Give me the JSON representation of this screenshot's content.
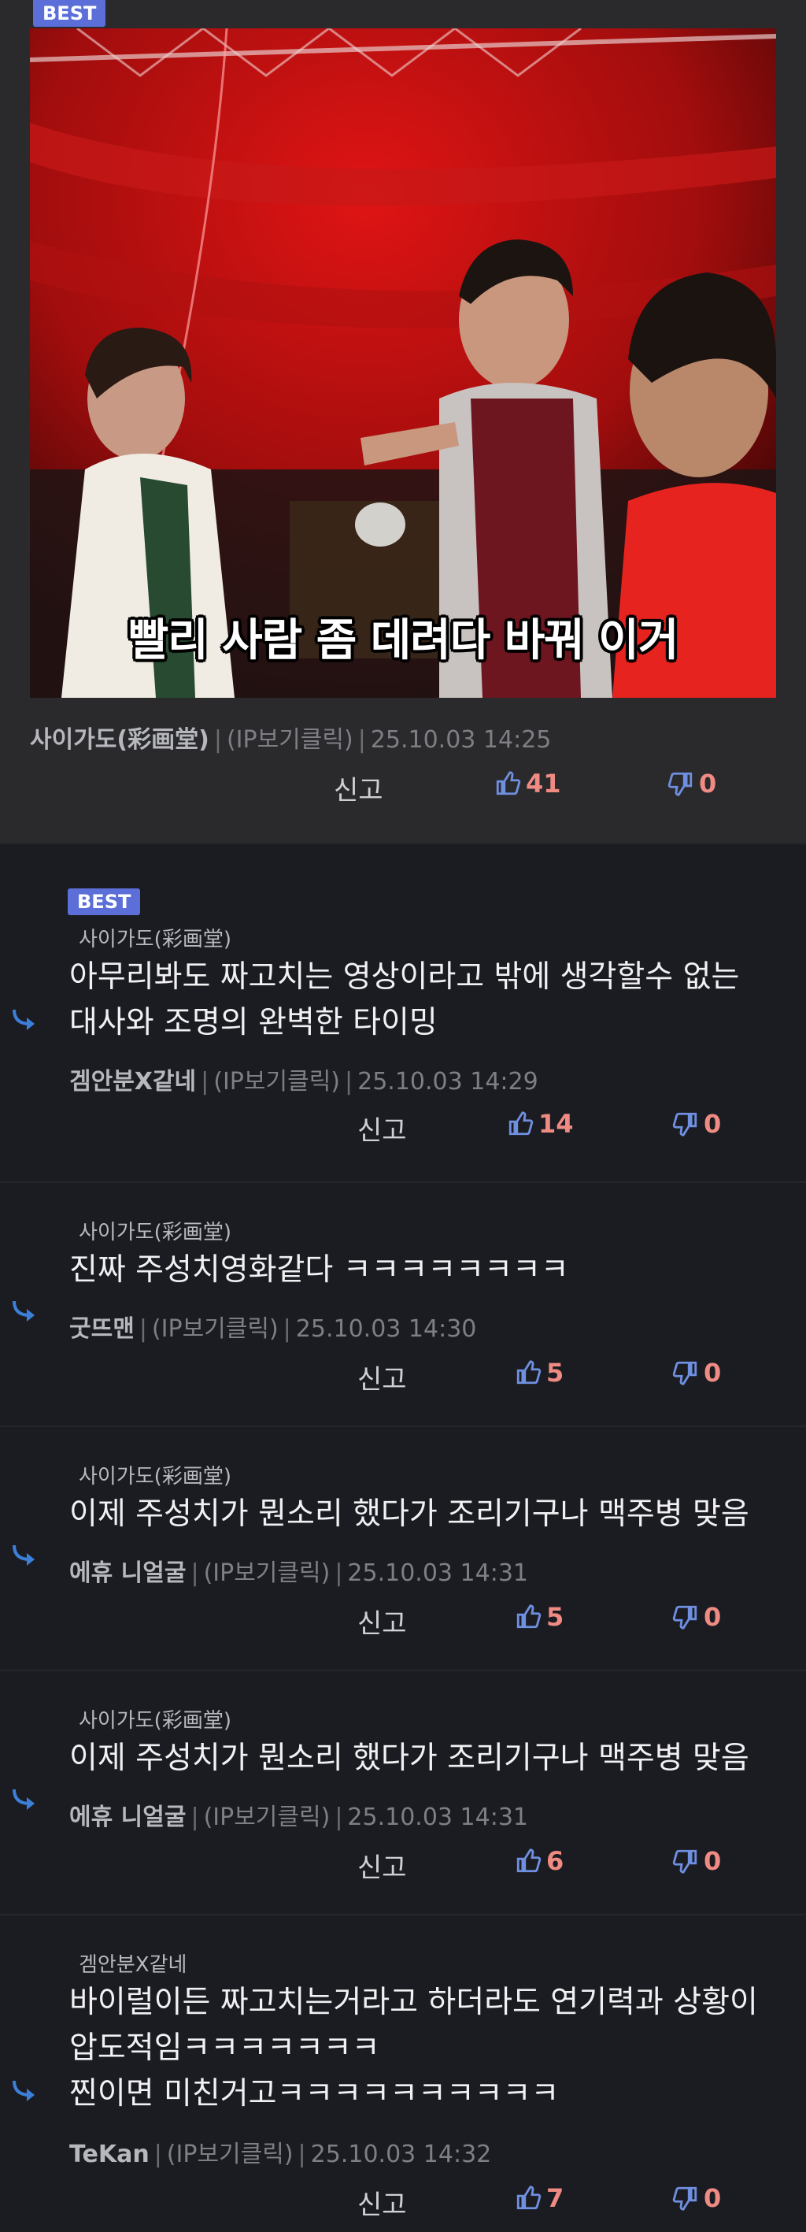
{
  "top": {
    "badge": "BEST",
    "subtitle": "빨리 사람 좀 데려다 바꿔 이거",
    "author": "사이가도(彩画堂)",
    "ip": "(IP보기클릭)",
    "time": "25.10.03 14:25",
    "report": "신고",
    "likes": "41",
    "dislikes": "0"
  },
  "replies": [
    {
      "badge": "BEST",
      "parent": "사이가도(彩画堂)",
      "lines": [
        "아무리봐도 짜고치는 영상이라고 밖에 생각할수 없는",
        "대사와 조명의 완벽한 타이밍"
      ],
      "author": "겜안분X같네",
      "ip": "(IP보기클릭)",
      "time": "25.10.03 14:29",
      "report": "신고",
      "likes": "14",
      "dislikes": "0"
    },
    {
      "parent": "사이가도(彩画堂)",
      "lines": [
        "진짜 주성치영화같다 ㅋㅋㅋㅋㅋㅋㅋㅋ"
      ],
      "author": "굿뜨맨",
      "ip": "(IP보기클릭)",
      "time": "25.10.03 14:30",
      "report": "신고",
      "likes": "5",
      "dislikes": "0"
    },
    {
      "parent": "사이가도(彩画堂)",
      "lines": [
        "이제 주성치가 뭔소리 했다가 조리기구나 맥주병 맞음"
      ],
      "author": "에휴 니얼굴",
      "ip": "(IP보기클릭)",
      "time": "25.10.03 14:31",
      "report": "신고",
      "likes": "5",
      "dislikes": "0"
    },
    {
      "parent": "사이가도(彩画堂)",
      "lines": [
        "이제 주성치가 뭔소리 했다가 조리기구나 맥주병 맞음"
      ],
      "author": "에휴 니얼굴",
      "ip": "(IP보기클릭)",
      "time": "25.10.03 14:31",
      "report": "신고",
      "likes": "6",
      "dislikes": "0"
    },
    {
      "parent": "겜안분X같네",
      "lines": [
        "바이럴이든 짜고치는거라고 하더라도 연기력과 상황이",
        "압도적임ㅋㅋㅋㅋㅋㅋㅋ",
        "찐이면 미친거고ㅋㅋㅋㅋㅋㅋㅋㅋㅋㅋ"
      ],
      "author": "TeKan",
      "ip": "(IP보기클릭)",
      "time": "25.10.03 14:32",
      "report": "신고",
      "likes": "7",
      "dislikes": "0"
    }
  ],
  "colors": {
    "accent": "#5c6fd8",
    "vote": "#ef8b82",
    "thumb": "#6f8fe0"
  }
}
